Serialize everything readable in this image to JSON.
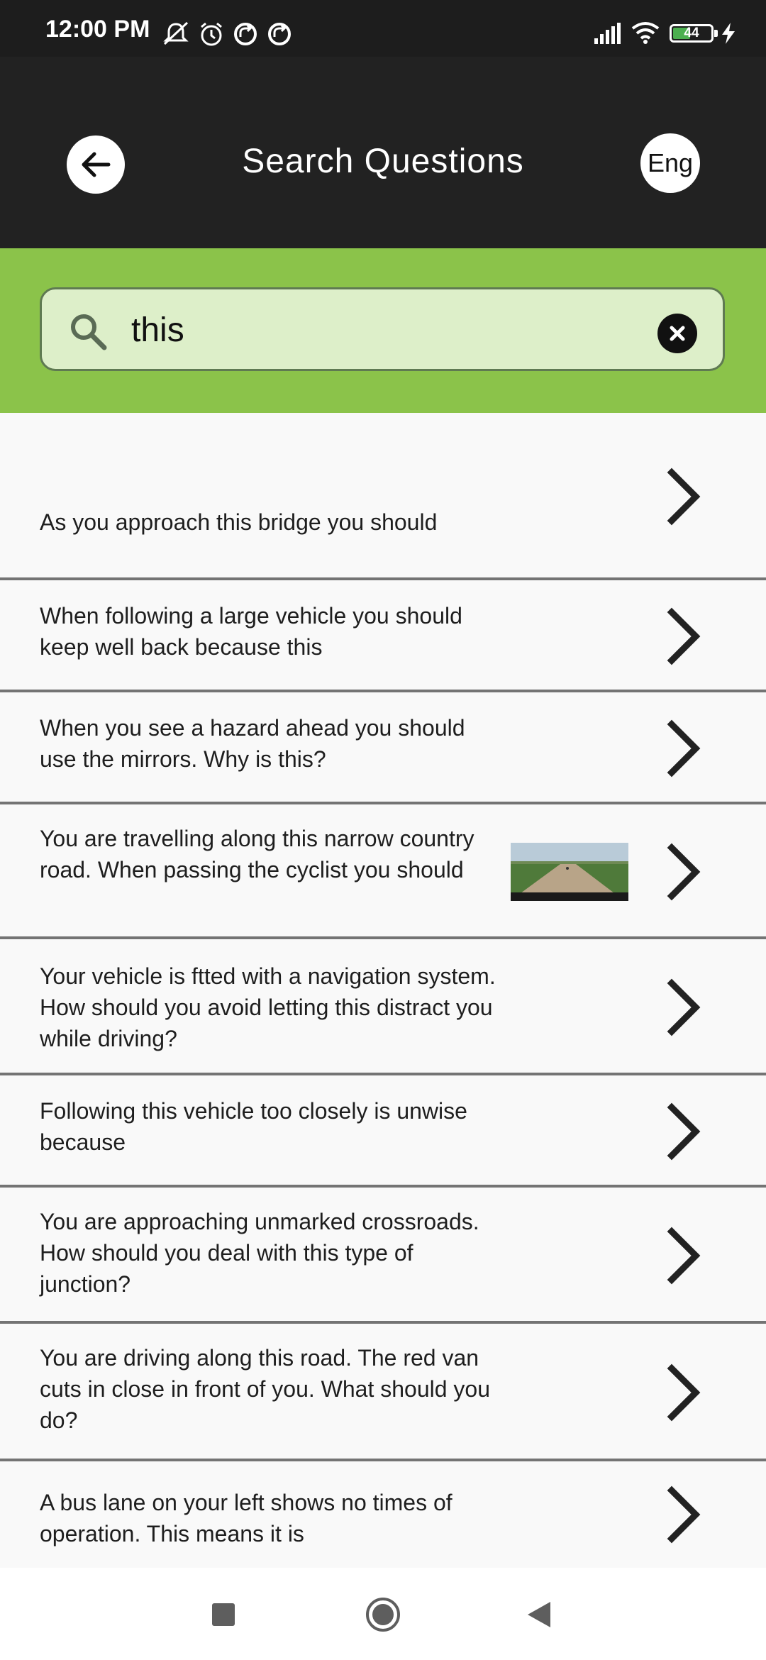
{
  "status_bar": {
    "time": "12:00 PM",
    "battery": "44",
    "icons": [
      "mute-icon",
      "alarm-icon",
      "sync-icon",
      "sync-icon",
      "signal-icon",
      "wifi-icon",
      "battery-icon",
      "charging-icon"
    ]
  },
  "header": {
    "title": "Search Questions",
    "language_label": "Eng",
    "background": "#222222"
  },
  "search": {
    "value": "this",
    "accent": "#8bc34a",
    "field_background": "#ddefc9"
  },
  "questions": [
    {
      "text": "As you approach this bridge you should",
      "has_image": false
    },
    {
      "text": "When following a large vehicle you should keep well back because this",
      "has_image": false
    },
    {
      "text": "When you see a hazard ahead you should use the mirrors. Why is this?",
      "has_image": false
    },
    {
      "text": "You are travelling along this narrow country road. When passing the cyclist you should",
      "has_image": true
    },
    {
      "text": "Your vehicle is ftted with a navigation system. How should you avoid letting this distract you while driving?",
      "has_image": false
    },
    {
      "text": "Following this vehicle too closely is unwise because",
      "has_image": false
    },
    {
      "text": "You are approaching unmarked crossroads. How should you deal with this type of junction?",
      "has_image": false
    },
    {
      "text": "You are driving along this road. The red van cuts in close in front of you. What should you do?",
      "has_image": false
    },
    {
      "text": "A bus lane on your left shows no times of operation. This means it is",
      "has_image": false
    }
  ],
  "nav_bar": {
    "buttons": [
      "recents-icon",
      "home-icon",
      "back-triangle-icon"
    ]
  }
}
